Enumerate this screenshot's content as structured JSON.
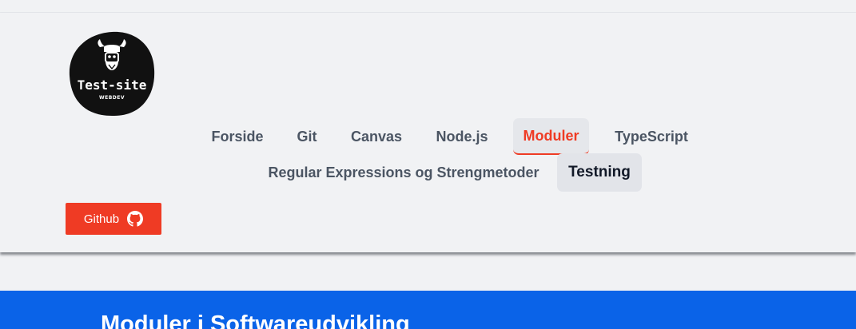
{
  "header": {
    "logo": {
      "text": "Test-site",
      "subtext": "WEBDEV"
    },
    "nav": {
      "forside": "Forside",
      "git": "Git",
      "canvas": "Canvas",
      "nodejs": "Node.js",
      "moduler": "Moduler",
      "typescript": "TypeScript",
      "regex": "Regular Expressions og Strengmetoder",
      "testning": "Testning"
    },
    "github_button": "Github"
  },
  "hero": {
    "title": "Moduler i Softwareudvikling"
  },
  "colors": {
    "accent": "#ef3b24",
    "hero_blue": "#0a63e8",
    "header_bg": "#f1f2f4"
  },
  "icons": {
    "github": "github-icon",
    "logo": "viking-mask-logo"
  }
}
